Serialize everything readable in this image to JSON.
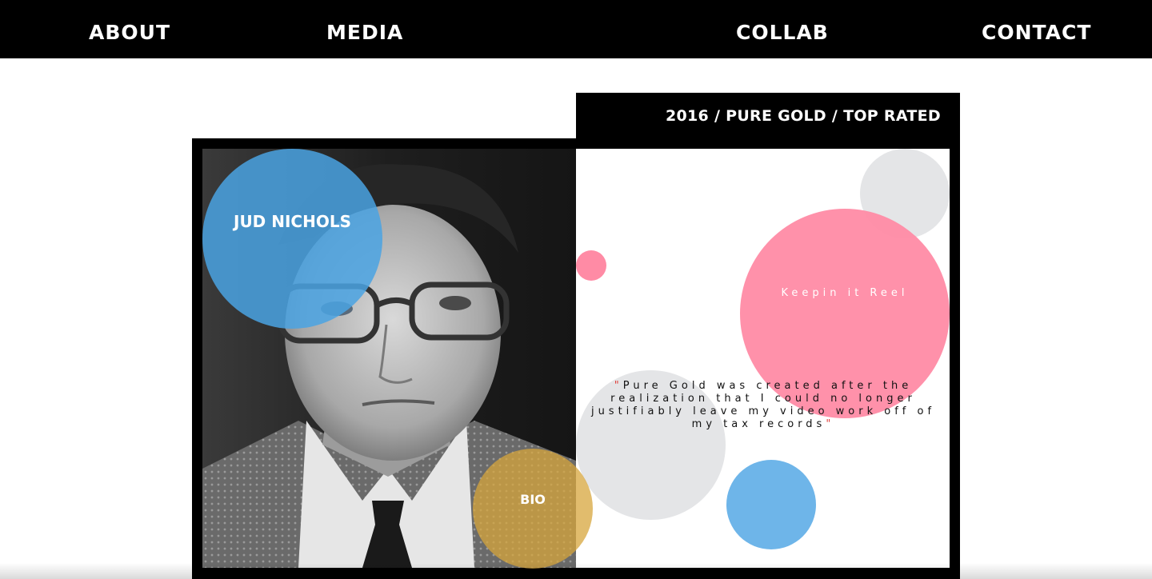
{
  "nav": {
    "about": "ABOUT",
    "media": "MEDIA",
    "collab": "COLLAB",
    "contact": "CONTACT"
  },
  "tab": {
    "text": "2016 / PURE GOLD / TOP RATED"
  },
  "hero": {
    "name": "JUD NICHOLS",
    "bio_label": "BIO"
  },
  "panel": {
    "reel_label": "Keepin it Reel",
    "quote_open": "\"",
    "quote_text": "Pure Gold was created after the realization that I could no longer justifiably leave my video work off of my tax records",
    "quote_close": "\""
  },
  "colors": {
    "blue": "#4aa3e3",
    "pink": "#ff8ba5",
    "gold": "#d7a63c",
    "grey": "#e4e5e7",
    "black": "#000000"
  }
}
